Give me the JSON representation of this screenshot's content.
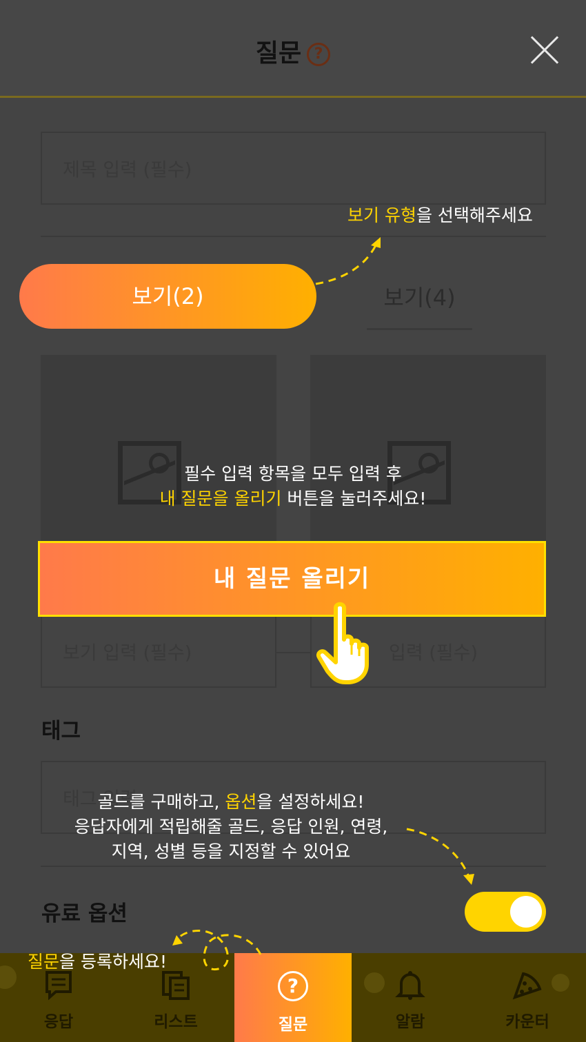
{
  "header": {
    "title": "질문",
    "help_icon": "?"
  },
  "form": {
    "title_placeholder": "제목 입력 (필수)",
    "tab_right_label": "보기(4)",
    "option_placeholder_left": "보기 입력 (필수)",
    "option_placeholder_right": "입력 (필수)",
    "tag_label": "태그",
    "tag_placeholder": "태그 입력",
    "paid_option_label": "유료 옵션"
  },
  "coach": {
    "pill_label": "보기(2)",
    "tip_type_hl": "보기 유형",
    "tip_type_rest": "을 선택해주세요",
    "tip_submit_line1": "필수 입력 항목을 모두 입력 후",
    "tip_submit_hl": "내 질문을 올리기",
    "tip_submit_rest": " 버튼을 눌러주세요!",
    "cta_label": "내 질문 올리기",
    "tip_gold_pre": "골드를 구매하고, ",
    "tip_gold_hl": "옵션",
    "tip_gold_post": "을 설정하세요!",
    "tip_gold_line2": "응답자에게 적립해줄 골드, 응답 인원, 연령,",
    "tip_gold_line3": "지역, 성별 등을 지정할 수 있어요",
    "tip_register_hl": "질문",
    "tip_register_rest": "을 등록하세요!"
  },
  "nav": {
    "items": [
      {
        "label": "응답",
        "icon": "answer-icon"
      },
      {
        "label": "리스트",
        "icon": "list-icon"
      },
      {
        "label": "질문",
        "icon": "question-icon"
      },
      {
        "label": "알람",
        "icon": "bell-icon"
      },
      {
        "label": "카운터",
        "icon": "pizza-icon"
      }
    ]
  },
  "colors": {
    "accent_yellow": "#ffd400",
    "gradient_start": "#ff7a4a",
    "gradient_end": "#ffb000",
    "dim_bg": "#444444"
  },
  "toggle": {
    "paid_option_on": true
  }
}
